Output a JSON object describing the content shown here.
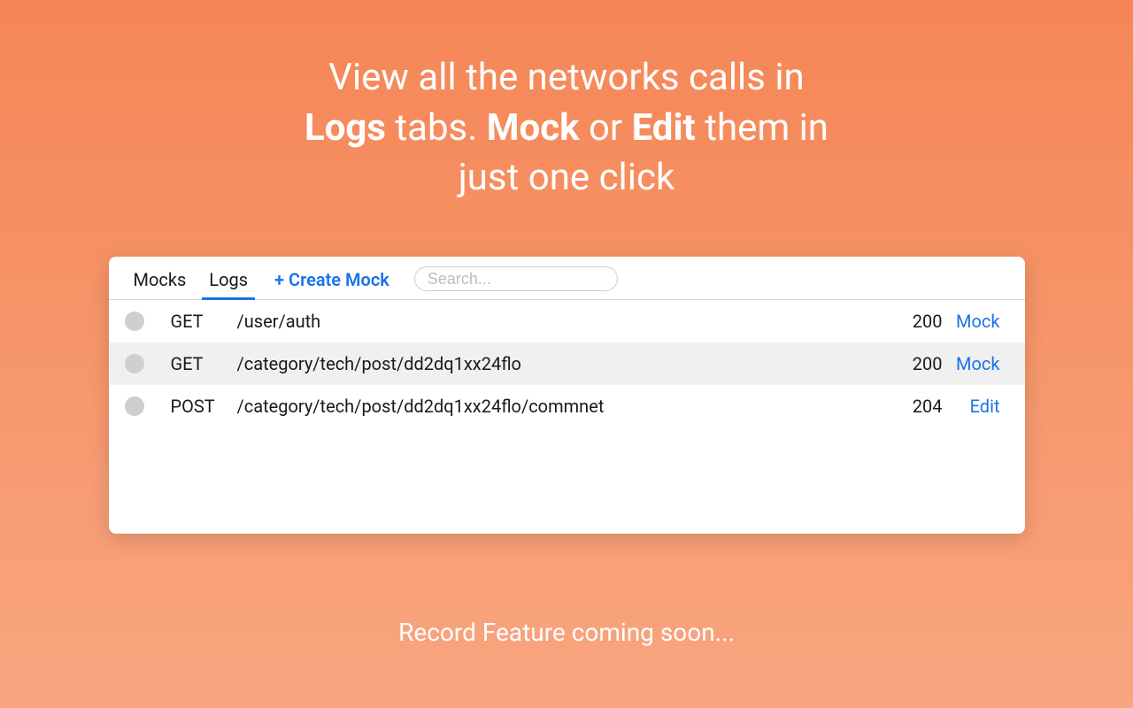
{
  "headline": {
    "part1": "View all the networks calls in",
    "bold1": "Logs",
    "part2": " tabs. ",
    "bold2": "Mock",
    "part3": " or ",
    "bold3": "Edit",
    "part4": " them in",
    "part5": "just one click"
  },
  "tabs": {
    "mocks": "Mocks",
    "logs": "Logs"
  },
  "create_button": "+ Create Mock",
  "search": {
    "placeholder": "Search..."
  },
  "rows": [
    {
      "method": "GET",
      "path": "/user/auth",
      "code": "200",
      "action": "Mock"
    },
    {
      "method": "GET",
      "path": "/category/tech/post/dd2dq1xx24flo",
      "code": "200",
      "action": "Mock"
    },
    {
      "method": "POST",
      "path": "/category/tech/post/dd2dq1xx24flo/commnet",
      "code": "204",
      "action": "Edit"
    }
  ],
  "footer": "Record Feature coming soon..."
}
